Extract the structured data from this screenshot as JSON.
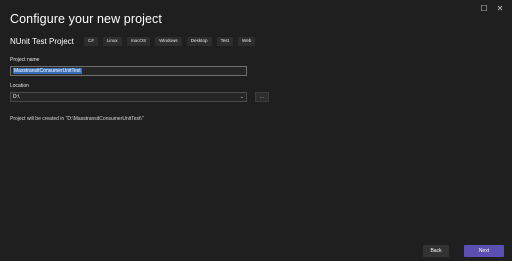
{
  "window": {
    "controls": [
      "☐",
      "✕"
    ]
  },
  "header": {
    "title": "Configure your new project"
  },
  "template": {
    "name": "NUnit Test Project",
    "tags": [
      "C#",
      "Linux",
      "macOS",
      "Windows",
      "Desktop",
      "Test",
      "Web"
    ]
  },
  "form": {
    "project_name_label": "Project name",
    "project_name_value": "MasstransitConsumerUnitTest",
    "location_label": "Location",
    "location_value": "D:\\",
    "browse_label": "...",
    "info_text": "Project will be created in \"D:\\MasstransitConsumerUnitTest\\\""
  },
  "footer": {
    "back_label": "Back",
    "next_label": "Next"
  },
  "colors": {
    "background": "#1f1f1f",
    "accent": "#5b4fb1",
    "selection": "#3c6fb8"
  }
}
